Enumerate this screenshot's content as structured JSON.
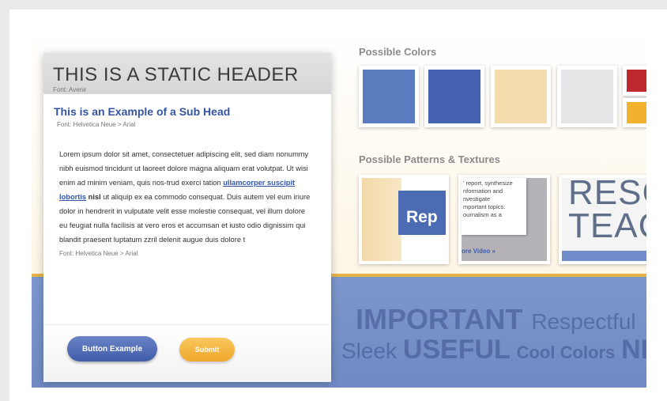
{
  "card": {
    "header_title": "THIS IS A STATIC HEADER",
    "header_font": "Font: Avenir",
    "subhead": "This is an Example of a Sub Head",
    "subhead_font": "Font: Helvetica Neue > Arial",
    "body_part1": "Lorem ipsum dolor sit amet, consectetuer adipiscing elit, sed diam nonummy nibh euismod tincidunt ut laoreet dolore magna aliquam erat volutpat. Ut wisi enim ad minim veniam, quis nos-trud exerci tation ",
    "body_link": "ullamcorper suscipit lobortis",
    "body_bold": " nisl",
    "body_part2": " ut aliquip ex ea commodo consequat. Duis autem vel eum iriure dolor in hendrerit in vulputate velit esse molestie consequat, vel illum dolore eu feugiat nulla facilisis at vero eros et accumsan et iusto odio dignissim qui blandit praesent luptatum zzril delenit augue duis dolore t",
    "body_font": "Font: Helvetica Neue > Arial",
    "button_example": "Button Example",
    "button_submit": "Submit"
  },
  "colors_section": {
    "title": "Possible Colors",
    "swatches": [
      "#5b7bbf",
      "#4662b2",
      "#f5dcac",
      "#e5e5e7",
      "#c0282f",
      "#f2b230"
    ]
  },
  "patterns_section": {
    "title": "Possible Patterns & Textures",
    "tex1_word": "Rep",
    "tex2_lines": [
      "’ report, synthesize",
      "nformation and",
      "nvestigate",
      "mportant topics:",
      "ournalism as a"
    ],
    "tex2_link": "ore Video »",
    "tex3_lines": [
      "RESC",
      "TEAC"
    ]
  },
  "banner": {
    "w_important": "IMPORTANT",
    "w_respectful": "Respectful",
    "w_sleek": "Sleek",
    "w_useful": "USEFUL",
    "w_cool": "Cool Colors",
    "w_new": "NEV"
  }
}
